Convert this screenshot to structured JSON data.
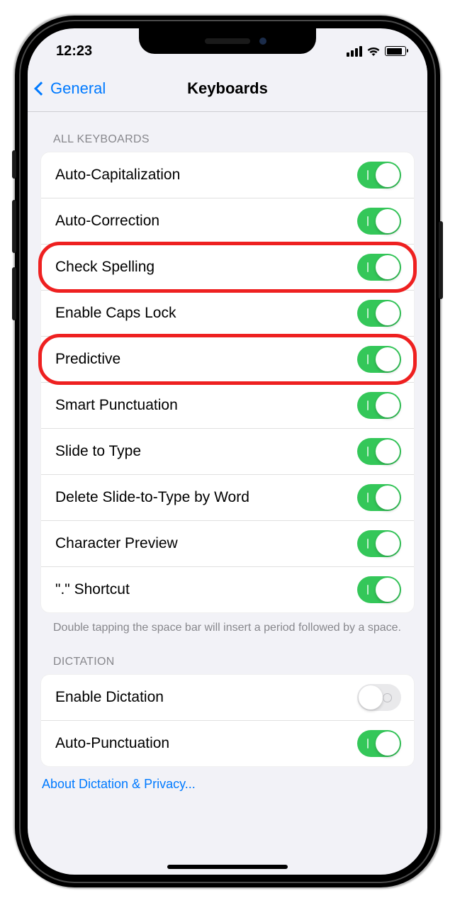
{
  "status": {
    "time": "12:23"
  },
  "nav": {
    "back": "General",
    "title": "Keyboards"
  },
  "section1": {
    "header": "ALL KEYBOARDS",
    "rows": [
      {
        "label": "Auto-Capitalization",
        "on": true,
        "hl": false
      },
      {
        "label": "Auto-Correction",
        "on": true,
        "hl": false
      },
      {
        "label": "Check Spelling",
        "on": true,
        "hl": true
      },
      {
        "label": "Enable Caps Lock",
        "on": true,
        "hl": false
      },
      {
        "label": "Predictive",
        "on": true,
        "hl": true
      },
      {
        "label": "Smart Punctuation",
        "on": true,
        "hl": false
      },
      {
        "label": "Slide to Type",
        "on": true,
        "hl": false
      },
      {
        "label": "Delete Slide-to-Type by Word",
        "on": true,
        "hl": false
      },
      {
        "label": "Character Preview",
        "on": true,
        "hl": false
      },
      {
        "label": "\".\" Shortcut",
        "on": true,
        "hl": false
      }
    ],
    "footer": "Double tapping the space bar will insert a period followed by a space."
  },
  "section2": {
    "header": "DICTATION",
    "rows": [
      {
        "label": "Enable Dictation",
        "on": false
      },
      {
        "label": "Auto-Punctuation",
        "on": true
      }
    ],
    "link": "About Dictation & Privacy..."
  }
}
